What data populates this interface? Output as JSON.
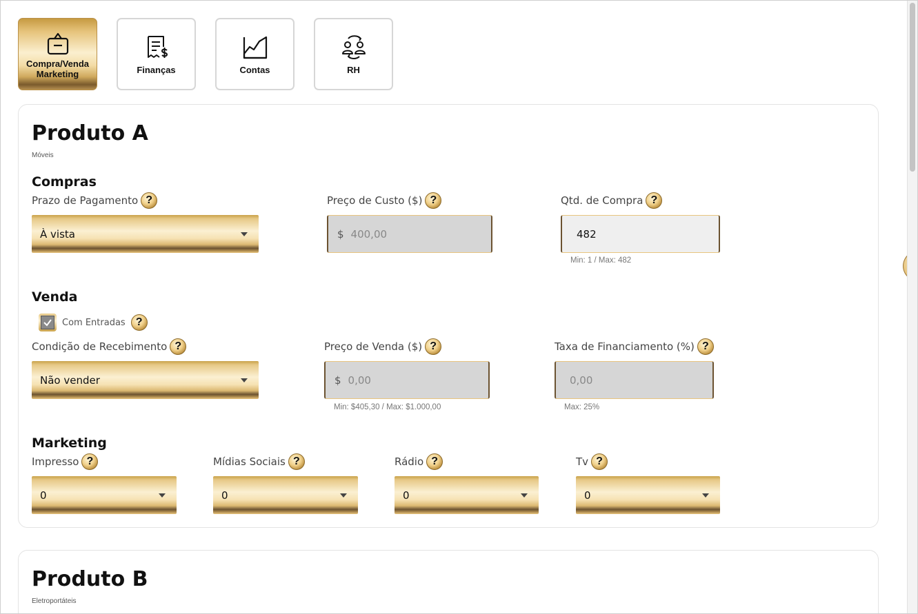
{
  "nav": {
    "items": [
      {
        "label": "Compra/Venda\nMarketing",
        "icon": "basket-icon",
        "active": true
      },
      {
        "label": "Finanças",
        "icon": "receipt-dollar-icon",
        "active": false
      },
      {
        "label": "Contas",
        "icon": "line-chart-icon",
        "active": false
      },
      {
        "label": "RH",
        "icon": "people-exchange-icon",
        "active": false
      }
    ]
  },
  "product_a": {
    "title": "Produto A",
    "category": "Móveis",
    "compras": {
      "title": "Compras",
      "prazo_label": "Prazo de Pagamento",
      "prazo_value": "À vista",
      "custo_label": "Preço de Custo ($)",
      "custo_prefix": "$",
      "custo_value": "400,00",
      "qtd_label": "Qtd. de Compra",
      "qtd_value": "482",
      "qtd_hint": "Min: 1 / Max: 482"
    },
    "venda": {
      "title": "Venda",
      "com_entradas_label": "Com Entradas",
      "com_entradas_checked": true,
      "condicao_label": "Condição de Recebimento",
      "condicao_value": "Não vender",
      "preco_label": "Preço de Venda ($)",
      "preco_prefix": "$",
      "preco_value": "0,00",
      "preco_hint": "Min: $405,30 / Max: $1.000,00",
      "taxa_label": "Taxa de Financiamento (%)",
      "taxa_value": "0,00",
      "taxa_hint": "Max: 25%"
    },
    "marketing": {
      "title": "Marketing",
      "channels": [
        {
          "label": "Impresso",
          "value": "0"
        },
        {
          "label": "Mídias Sociais",
          "value": "0"
        },
        {
          "label": "Rádio",
          "value": "0"
        },
        {
          "label": "Tv",
          "value": "0"
        }
      ]
    }
  },
  "product_b": {
    "title": "Produto B",
    "category": "Eletroportáteis"
  },
  "help_glyph": "?",
  "colors": {
    "gold_light": "#fbf0d2",
    "gold_mid": "#e6c37b",
    "gold_dark": "#6b5230",
    "disabled_input": "#d6d6d6"
  }
}
